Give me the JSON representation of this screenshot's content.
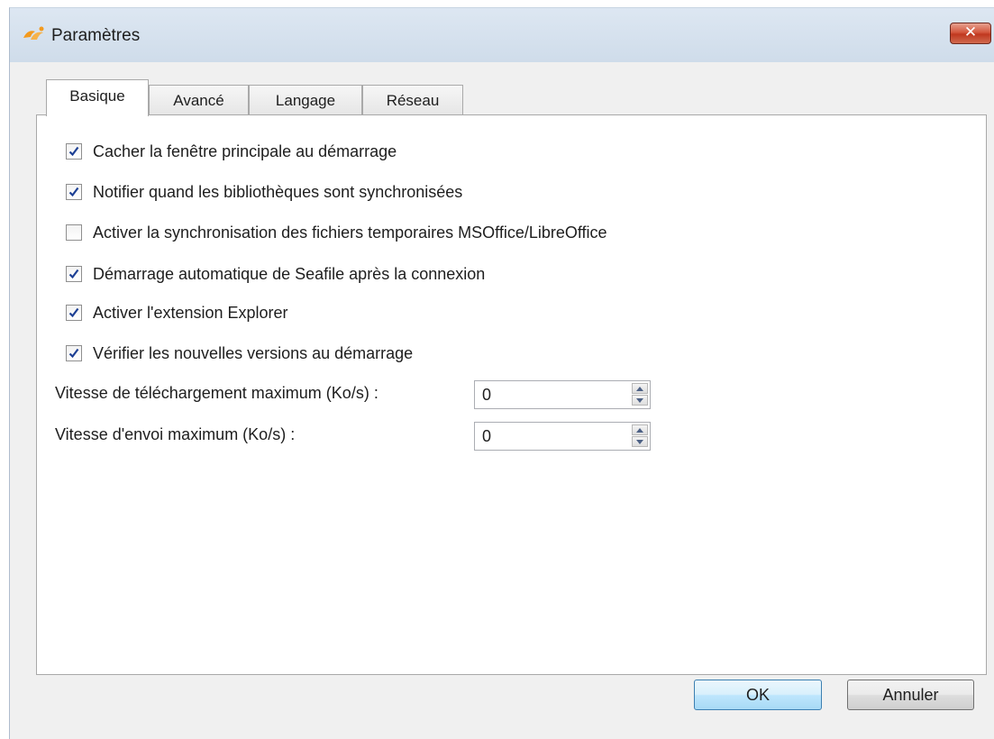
{
  "window": {
    "title": "Paramètres",
    "app_icon": "seafile-logo-icon",
    "close_icon": "close-icon",
    "close_glyph": "✕"
  },
  "tabs": [
    {
      "label": "Basique",
      "active": true
    },
    {
      "label": "Avancé",
      "active": false
    },
    {
      "label": "Langage",
      "active": false
    },
    {
      "label": "Réseau",
      "active": false
    }
  ],
  "options": [
    {
      "label": "Cacher la fenêtre principale au démarrage",
      "checked": true
    },
    {
      "label": "Notifier quand les bibliothèques sont synchronisées",
      "checked": true
    },
    {
      "label": "Activer la synchronisation des fichiers temporaires MSOffice/LibreOffice",
      "checked": false
    },
    {
      "label": "Démarrage automatique de Seafile après la connexion",
      "checked": true
    },
    {
      "label": "Activer l'extension Explorer",
      "checked": true
    },
    {
      "label": "Vérifier les nouvelles versions au démarrage",
      "checked": true
    }
  ],
  "fields": {
    "download_speed": {
      "label": "Vitesse de téléchargement maximum (Ko/s) :",
      "value": "0"
    },
    "upload_speed": {
      "label": "Vitesse d'envoi maximum (Ko/s) :",
      "value": "0"
    }
  },
  "buttons": {
    "ok_label": "OK",
    "cancel_label": "Annuler"
  },
  "colors": {
    "checkmark": "#1c3f94",
    "app_icon_orange": "#f39a1e"
  }
}
